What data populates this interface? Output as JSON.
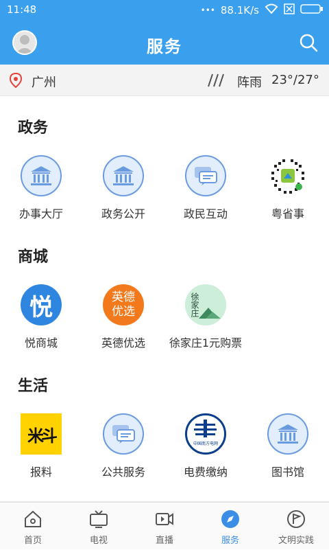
{
  "status_bar": {
    "time": "11:48",
    "network_speed": "88.1K/s",
    "dots": "•••"
  },
  "header": {
    "title": "服务"
  },
  "weather": {
    "city": "广州",
    "condition": "阵雨",
    "temperature": "23°/27°"
  },
  "sections": [
    {
      "title": "政务",
      "items": [
        {
          "label": "办事大厅",
          "icon": "government-building-icon"
        },
        {
          "label": "政务公开",
          "icon": "government-building-icon"
        },
        {
          "label": "政民互动",
          "icon": "chat-bubbles-icon"
        },
        {
          "label": "粤省事",
          "icon": "mini-program-qr-icon"
        }
      ]
    },
    {
      "title": "商城",
      "items": [
        {
          "label": "悦商城",
          "icon": "yue-mall-icon",
          "icon_text": "悦"
        },
        {
          "label": "英德优选",
          "icon": "yingde-select-icon",
          "icon_text_1": "英德",
          "icon_text_2": "优选"
        },
        {
          "label": "徐家庄1元购票",
          "icon": "xujiazhuang-icon",
          "icon_text": "徐家庄"
        }
      ]
    },
    {
      "title": "生活",
      "items": [
        {
          "label": "报料",
          "icon": "report-news-icon",
          "icon_text": "米斗"
        },
        {
          "label": "公共服务",
          "icon": "chat-bubbles-icon"
        },
        {
          "label": "电费缴纳",
          "icon": "china-southern-grid-icon",
          "icon_text": "中国南方电网"
        },
        {
          "label": "图书馆",
          "icon": "library-building-icon"
        }
      ]
    }
  ],
  "tabbar": [
    {
      "label": "首页",
      "icon": "home-icon",
      "active": false
    },
    {
      "label": "电视",
      "icon": "tv-icon",
      "active": false
    },
    {
      "label": "直播",
      "icon": "live-video-icon",
      "active": false
    },
    {
      "label": "服务",
      "icon": "compass-icon",
      "active": true
    },
    {
      "label": "文明实践",
      "icon": "flag-icon",
      "active": false
    }
  ],
  "colors": {
    "brand": "#3aa0ee",
    "active_tab": "#3a8ee6",
    "icon_stroke": "#6a9be0",
    "icon_fill": "#e3eefc"
  }
}
